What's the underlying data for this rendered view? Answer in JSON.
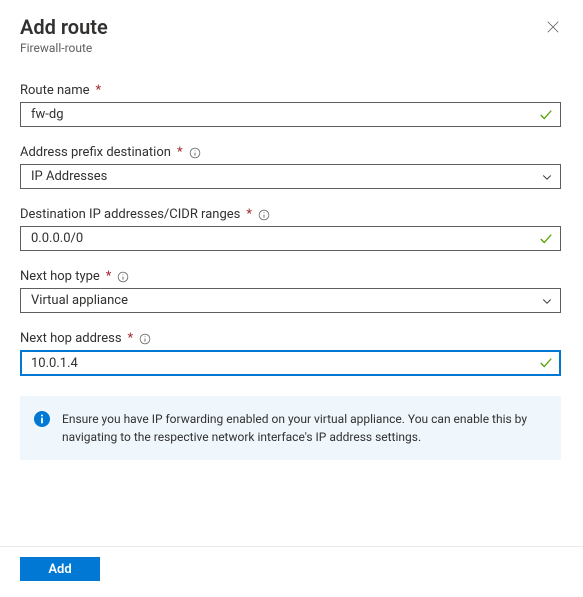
{
  "header": {
    "title": "Add route",
    "subtitle": "Firewall-route"
  },
  "fields": {
    "route_name": {
      "label": "Route name",
      "value": "fw-dg"
    },
    "address_prefix": {
      "label": "Address prefix destination",
      "value": "IP Addresses"
    },
    "dest_ip": {
      "label": "Destination IP addresses/CIDR ranges",
      "value": "0.0.0.0/0"
    },
    "next_hop_type": {
      "label": "Next hop type",
      "value": "Virtual appliance"
    },
    "next_hop_address": {
      "label": "Next hop address",
      "value": "10.0.1.4"
    }
  },
  "info_message": "Ensure you have IP forwarding enabled on your virtual appliance. You can enable this by navigating to the respective network interface's IP address settings.",
  "footer": {
    "add_label": "Add"
  }
}
